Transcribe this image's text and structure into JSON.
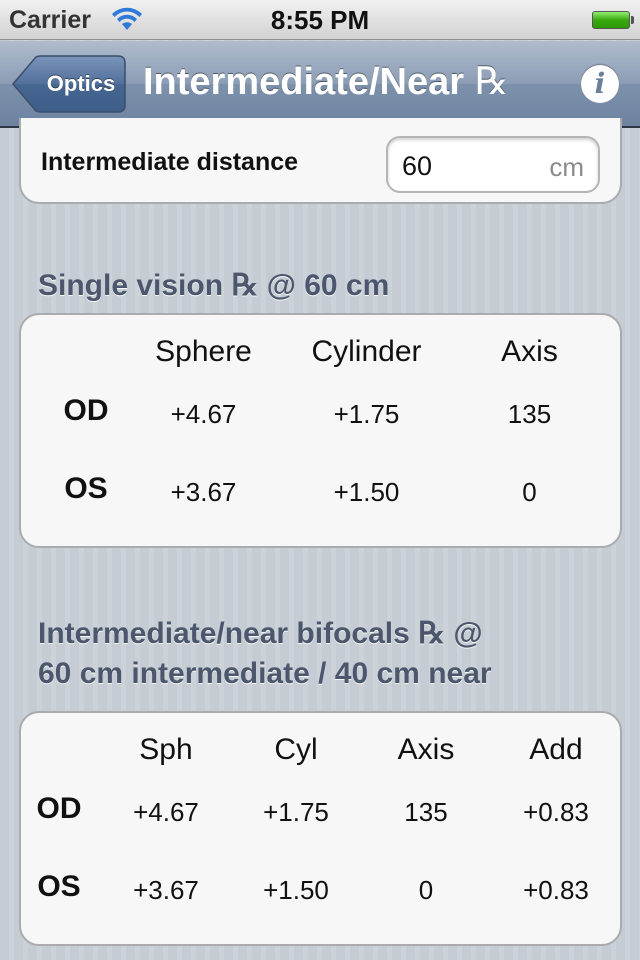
{
  "status_bar": {
    "carrier": "Carrier",
    "time": "8:55 PM",
    "wifi_icon": "wifi-icon",
    "battery_icon": "battery-full-icon",
    "battery_color": "#3aa80f"
  },
  "nav": {
    "back_label": "Optics",
    "title": "Intermediate/Near",
    "title_rx": "℞",
    "info_icon": "info-icon",
    "info_glyph": "i"
  },
  "distance": {
    "label": "Intermediate distance",
    "value": "60",
    "unit": "cm"
  },
  "single_vision": {
    "header": "Single vision ℞ @ 60 cm",
    "columns": [
      "Sphere",
      "Cylinder",
      "Axis"
    ],
    "rows": [
      {
        "eye": "OD",
        "values": [
          "+4.67",
          "+1.75",
          "135"
        ]
      },
      {
        "eye": "OS",
        "values": [
          "+3.67",
          "+1.50",
          "0"
        ]
      }
    ]
  },
  "bifocals": {
    "header_line1": "Intermediate/near bifocals ℞ @",
    "header_line2": "60 cm intermediate / 40 cm near",
    "columns": [
      "Sph",
      "Cyl",
      "Axis",
      "Add"
    ],
    "rows": [
      {
        "eye": "OD",
        "values": [
          "+4.67",
          "+1.75",
          "135",
          "+0.83"
        ]
      },
      {
        "eye": "OS",
        "values": [
          "+3.67",
          "+1.50",
          "0",
          "+0.83"
        ]
      }
    ]
  },
  "colors": {
    "nav_bar": "#7d91ab",
    "back_button": "#4f6e9a",
    "section_header": "#4c566c",
    "card_background": "#f7f7f7",
    "page_background": "#c5ccd4"
  }
}
